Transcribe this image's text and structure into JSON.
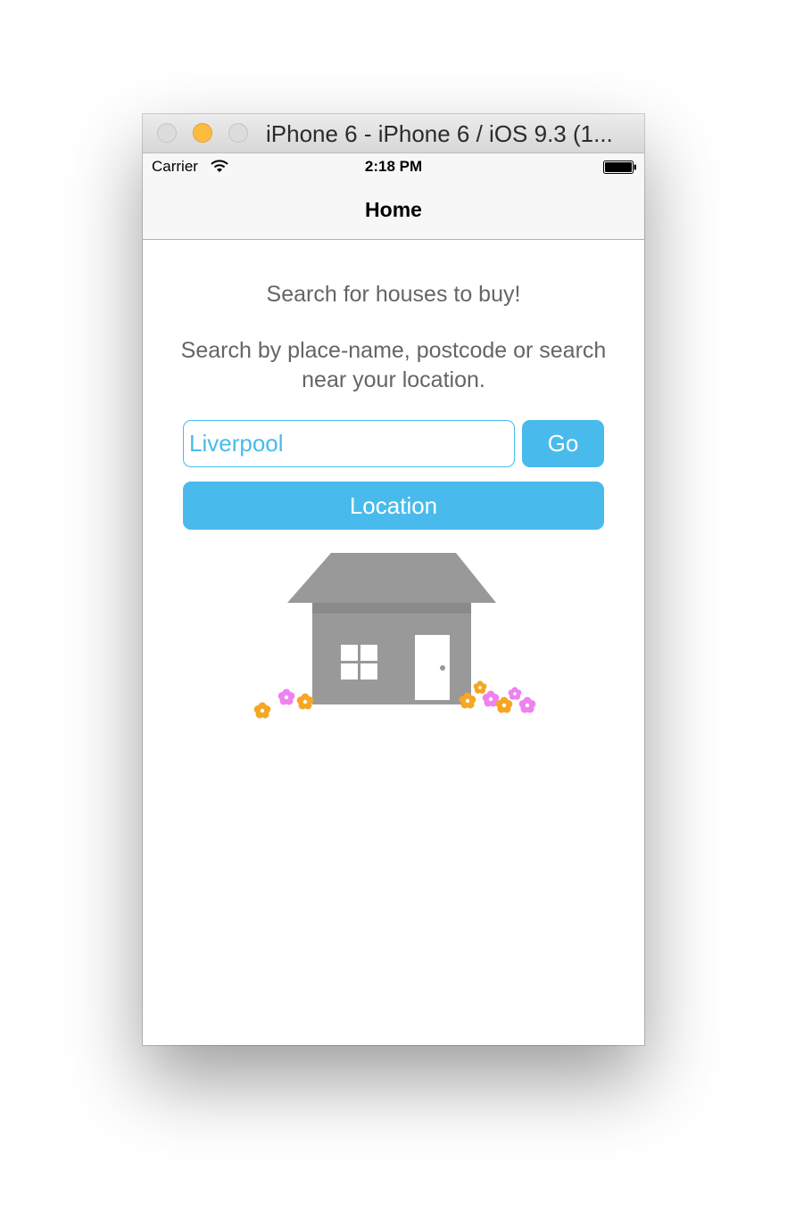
{
  "window": {
    "title": "iPhone 6 - iPhone 6 / iOS 9.3 (1..."
  },
  "status_bar": {
    "carrier": "Carrier",
    "time": "2:18 PM"
  },
  "nav": {
    "title": "Home"
  },
  "main": {
    "headline": "Search for houses to buy!",
    "description": "Search by place-name, postcode or search near your location.",
    "search": {
      "value": "Liverpool",
      "go_label": "Go"
    },
    "location_label": "Location"
  },
  "colors": {
    "accent": "#48bbec",
    "text_gray": "#656565",
    "house_gray": "#999999",
    "flower_orange": "#f5a623",
    "flower_pink": "#ee82ee"
  },
  "icons": [
    "wifi-icon",
    "battery-icon",
    "house-illustration"
  ]
}
